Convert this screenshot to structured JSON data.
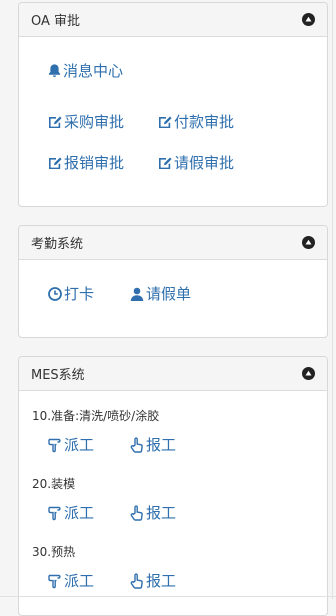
{
  "oa": {
    "title": "OA 审批",
    "links": {
      "message_center": "消息中心",
      "purchase": "采购审批",
      "payment": "付款审批",
      "reimburse": "报销审批",
      "leave": "请假审批"
    }
  },
  "attendance": {
    "title": "考勤系统",
    "links": {
      "clock_in": "打卡",
      "leave_form": "请假单"
    }
  },
  "mes": {
    "title": "MES系统",
    "sections": [
      {
        "label": "10.准备:清洗/喷砂/涂胶",
        "dispatch": "派工",
        "report": "报工"
      },
      {
        "label": "20.装模",
        "dispatch": "派工",
        "report": "报工"
      },
      {
        "label": "30.预热",
        "dispatch": "派工",
        "report": "报工"
      }
    ]
  },
  "colors": {
    "link": "#2f6fad",
    "panel_header": "#f5f5f5"
  }
}
